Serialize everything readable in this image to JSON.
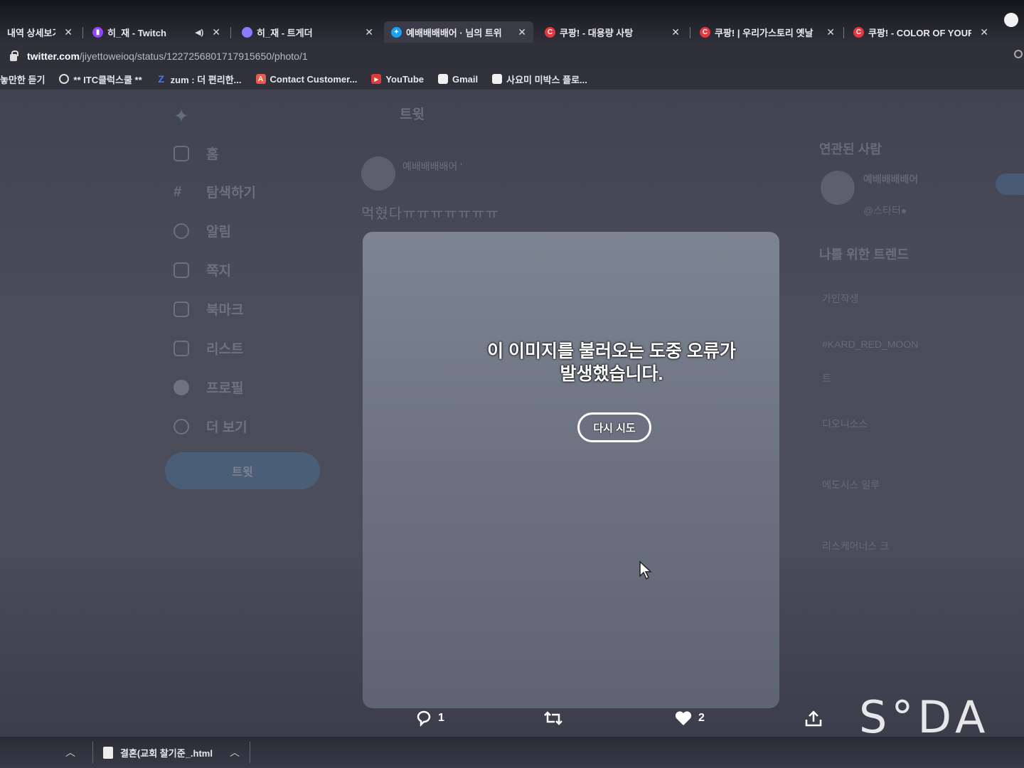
{
  "tabs": [
    {
      "title": "내역 상세보기 |",
      "favicon_color": "#888888"
    },
    {
      "title": "히_재 - Twitch",
      "favicon_color": "#9146ff"
    },
    {
      "title": "히_재 - 트게더",
      "favicon_color": "#8b7cff",
      "muted": true
    },
    {
      "title": "예배배배배어 · 님의 트위",
      "favicon_color": "#1da1f2"
    },
    {
      "title": "쿠팡! - 대용량 사탕",
      "favicon_color": "#e2383f"
    },
    {
      "title": "쿠팡! | 우리가스토리 옛날",
      "favicon_color": "#e2383f"
    },
    {
      "title": "쿠팡! - COLOR OF YOUR",
      "favicon_color": "#e2383f"
    }
  ],
  "address": {
    "host": "twitter.com",
    "path": "/jiyettoweioq/status/1227256801717915650/photo/1"
  },
  "bookmarks": [
    {
      "label": "놓만한 듣기",
      "icon_color": "#cccccc"
    },
    {
      "label": "** ITC클럭스쿨 **",
      "icon_color": "#dddddd"
    },
    {
      "label": "zum : 더 편리한...",
      "icon_color": "#3f7bff"
    },
    {
      "label": "Contact Customer...",
      "icon_color": "#e85a4f"
    },
    {
      "label": "YouTube",
      "icon_color": "#ff0000"
    },
    {
      "label": "Gmail",
      "icon_color": "#ffffff"
    },
    {
      "label": "사요미 미박스 플로...",
      "icon_color": "#ffffff"
    }
  ],
  "nav": {
    "items": [
      {
        "label": "홈",
        "icon": "home-icon"
      },
      {
        "label": "탐색하기",
        "icon": "hashtag-icon"
      },
      {
        "label": "알림",
        "icon": "bell-icon"
      },
      {
        "label": "쪽지",
        "icon": "mail-icon"
      },
      {
        "label": "북마크",
        "icon": "bookmark-icon"
      },
      {
        "label": "리스트",
        "icon": "list-icon"
      },
      {
        "label": "프로필",
        "icon": "profile-icon"
      },
      {
        "label": "더 보기",
        "icon": "more-icon"
      }
    ],
    "tweet_button": "트윗"
  },
  "tweet": {
    "header": "트윗",
    "author": "예배배배배어 '",
    "text": "먹혔다ㅠㅠㅠㅠㅠㅠㅠ"
  },
  "sidebar": {
    "related_title": "연관된 사람",
    "related_name": "예배배배배어",
    "related_handle": "@스타터●",
    "trends_title": "나를 위한 트렌드",
    "trends": [
      "가인작생",
      "#KARD_RED_MOON",
      "트",
      "디오니소스",
      "에도시스 일루",
      "리스케어너스 크"
    ]
  },
  "media": {
    "error_line1": "이 이미지를 불러오는 도중 오류가",
    "error_line2": "발생했습니다.",
    "retry_label": "다시 시도"
  },
  "actions": {
    "reply_count": "1",
    "like_count": "2"
  },
  "watermark": "S°DA",
  "downloads": {
    "file_name": "결혼(교회 찰기준_.html"
  },
  "colors": {
    "accent": "#1da1f2",
    "card_bg": "#6c7280",
    "page_bg": "#4a4c5a"
  }
}
